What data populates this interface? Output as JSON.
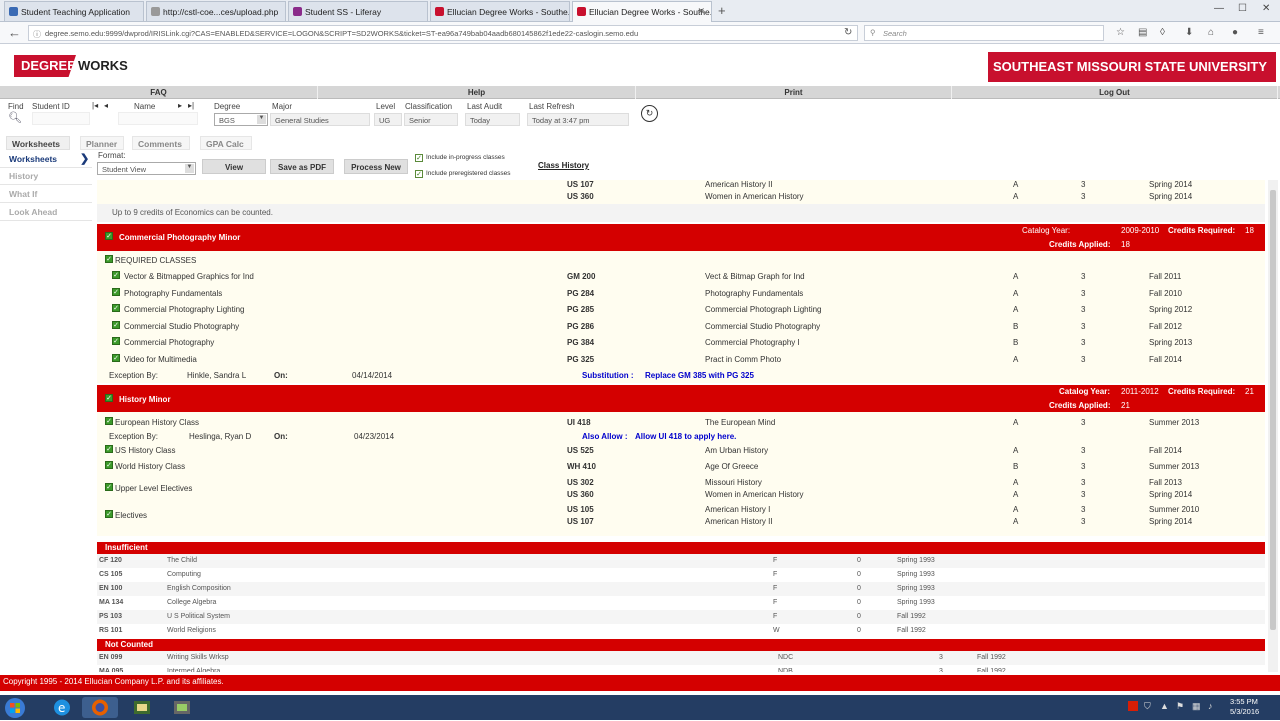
{
  "browser": {
    "tabs": [
      {
        "label": "Student Teaching Application",
        "icon_color": "#3a6ab4"
      },
      {
        "label": "http://cstl-coe...ces/upload.php",
        "icon_color": "#999999"
      },
      {
        "label": "Student SS - Liferay",
        "icon_color": "#8a2b8a"
      },
      {
        "label": "Ellucian Degree Works - Southe...",
        "icon_color": "#c8102e"
      },
      {
        "label": "Ellucian Degree Works - Southe...",
        "icon_color": "#c8102e"
      }
    ],
    "new_tab": "+",
    "close_glyph": "✕",
    "url": "degree.semo.edu:9999/dwprod/IRISLink.cgi?CAS=ENABLED&SERVICE=LOGON&SCRIPT=SD2WORKS&ticket=ST-ea96a749bab04aadb680145862f1ede22-caslogin.semo.edu",
    "search_placeholder": "Search",
    "win_min": "—",
    "win_max": "☐",
    "win_close": "✕"
  },
  "header": {
    "logo_degree": "DEGREE",
    "logo_works": "WORKS",
    "university": "SOUTHEAST MISSOURI STATE UNIVERSITY",
    "nav": [
      "FAQ",
      "Help",
      "Print",
      "Log Out"
    ]
  },
  "student": {
    "find_label": "Find",
    "id_label": "Student ID",
    "name_label": "Name",
    "degree_label": "Degree",
    "degree_value": "BGS",
    "major_label": "Major",
    "major_value": "General Studies",
    "level_label": "Level",
    "level_value": "UG",
    "class_label": "Classification",
    "class_value": "Senior",
    "audit_label": "Last Audit",
    "audit_value": "Today",
    "refresh_label": "Last Refresh",
    "refresh_value": "Today at 3:47 pm"
  },
  "tabs": [
    "Worksheets",
    "Planner",
    "Comments",
    "GPA Calc"
  ],
  "side_menu": [
    "Worksheets",
    "History",
    "What If",
    "Look Ahead"
  ],
  "toolbar": {
    "format_label": "Format:",
    "format_value": "Student View",
    "view": "View",
    "save_pdf": "Save as PDF",
    "process_new": "Process New",
    "inprogress": "Include in-progress classes",
    "preregistered": "Include preregistered classes",
    "class_history": "Class History"
  },
  "top_rows": [
    {
      "code": "US 107",
      "title": "American History II",
      "grade": "A",
      "credits": "3",
      "term": "Spring 2014"
    },
    {
      "code": "US 360",
      "title": "Women in American History",
      "grade": "A",
      "credits": "3",
      "term": "Spring 2014"
    }
  ],
  "econ_note": "Up to 9 credits of Economics can be counted.",
  "photo_minor": {
    "title": "Commercial Photography Minor",
    "catalog_label": "Catalog Year:",
    "catalog_value": "2009-2010",
    "req_label": "Credits Required:",
    "req_value": "18",
    "applied_label": "Credits Applied:",
    "applied_value": "18",
    "section": "REQUIRED CLASSES",
    "rows": [
      {
        "req": "Vector & Bitmapped Graphics for Ind",
        "code": "GM 200",
        "title": "Vect & Bitmap Graph for Ind",
        "grade": "A",
        "credits": "3",
        "term": "Fall 2011"
      },
      {
        "req": "Photography Fundamentals",
        "code": "PG 284",
        "title": "Photography Fundamentals",
        "grade": "A",
        "credits": "3",
        "term": "Fall 2010"
      },
      {
        "req": "Commercial Photography Lighting",
        "code": "PG 285",
        "title": "Commercial Photograph Lighting",
        "grade": "A",
        "credits": "3",
        "term": "Spring 2012"
      },
      {
        "req": "Commercial Studio Photography",
        "code": "PG 286",
        "title": "Commercial Studio Photography",
        "grade": "B",
        "credits": "3",
        "term": "Fall 2012"
      },
      {
        "req": "Commercial Photography",
        "code": "PG 384",
        "title": "Commercial Photography I",
        "grade": "B",
        "credits": "3",
        "term": "Spring 2013"
      },
      {
        "req": "Video for Multimedia",
        "code": "PG 325",
        "title": "Pract in Comm Photo",
        "grade": "A",
        "credits": "3",
        "term": "Fall 2014"
      }
    ],
    "exception_label": "Exception By:",
    "exception_by": "Hinkle, Sandra L",
    "on_label": "On:",
    "exception_date": "04/14/2014",
    "sub_label": "Substitution :",
    "sub_text": "Replace GM 385 with PG 325"
  },
  "history_minor": {
    "title": "History Minor",
    "catalog_label": "Catalog Year:",
    "catalog_value": "2011-2012",
    "req_label": "Credits Required:",
    "req_value": "21",
    "applied_label": "Credits Applied:",
    "applied_value": "21",
    "euro": {
      "req": "European History Class",
      "code": "UI 418",
      "title": "The European Mind",
      "grade": "A",
      "credits": "3",
      "term": "Summer 2013"
    },
    "exception_label": "Exception By:",
    "exception_by": "Heslinga, Ryan D",
    "on_label": "On:",
    "exception_date": "04/23/2014",
    "allow_label": "Also Allow :",
    "allow_text": "Allow UI 418 to apply here.",
    "us": {
      "req": "US History Class",
      "code": "US 525",
      "title": "Am Urban History",
      "grade": "A",
      "credits": "3",
      "term": "Fall 2014"
    },
    "world": {
      "req": "World History Class",
      "code": "WH 410",
      "title": "Age Of Greece",
      "grade": "B",
      "credits": "3",
      "term": "Summer 2013"
    },
    "upper": {
      "req": "Upper Level Electives",
      "rows": [
        {
          "code": "US 302",
          "title": "Missouri History",
          "grade": "A",
          "credits": "3",
          "term": "Fall 2013"
        },
        {
          "code": "US 360",
          "title": "Women in American History",
          "grade": "A",
          "credits": "3",
          "term": "Spring 2014"
        }
      ]
    },
    "electives": {
      "req": "Electives",
      "rows": [
        {
          "code": "US 105",
          "title": "American History I",
          "grade": "A",
          "credits": "3",
          "term": "Summer 2010"
        },
        {
          "code": "US 107",
          "title": "American History II",
          "grade": "A",
          "credits": "3",
          "term": "Spring 2014"
        }
      ]
    }
  },
  "insufficient": {
    "title": "Insufficient",
    "rows": [
      {
        "code": "CF 120",
        "title": "The Child",
        "grade": "F",
        "credits": "0",
        "term": "Spring 1993"
      },
      {
        "code": "CS 105",
        "title": "Computing",
        "grade": "F",
        "credits": "0",
        "term": "Spring 1993"
      },
      {
        "code": "EN 100",
        "title": "English Composition",
        "grade": "F",
        "credits": "0",
        "term": "Spring 1993"
      },
      {
        "code": "MA 134",
        "title": "College Algebra",
        "grade": "F",
        "credits": "0",
        "term": "Spring 1993"
      },
      {
        "code": "PS 103",
        "title": "U S Political System",
        "grade": "F",
        "credits": "0",
        "term": "Fall 1992"
      },
      {
        "code": "RS 101",
        "title": "World Religions",
        "grade": "W",
        "credits": "0",
        "term": "Fall 1992"
      }
    ]
  },
  "not_counted": {
    "title": "Not Counted",
    "rows": [
      {
        "code": "EN 099",
        "title": "Writing Skills Wrksp",
        "grade": "NDC",
        "credits": "3",
        "term": "Fall 1992"
      },
      {
        "code": "MA 095",
        "title": "Intermed Algebra",
        "grade": "NDB",
        "credits": "3",
        "term": "Fall 1992"
      }
    ]
  },
  "footer": "Copyright 1995 - 2014 Ellucian Company L.P. and its affiliates.",
  "taskbar": {
    "time": "3:55 PM",
    "date": "5/3/2016"
  },
  "colors": {
    "brand_red": "#c8102e",
    "bar_red": "#d40000",
    "cream": "#fffdf0",
    "taskbar": "#243d63"
  }
}
